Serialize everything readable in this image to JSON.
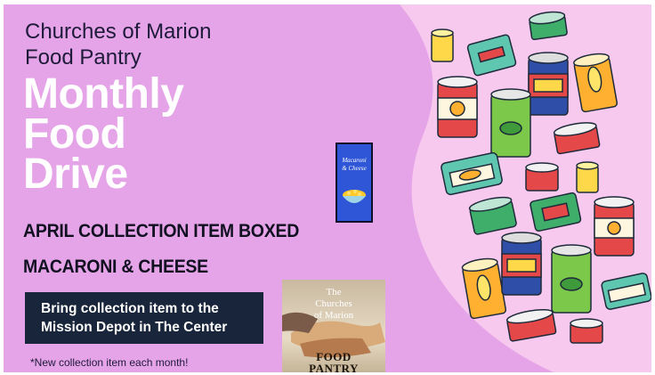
{
  "organization": {
    "line1": "Churches of Marion",
    "line2": "Food Pantry"
  },
  "headline": {
    "line1": "Monthly",
    "line2": "Food",
    "line3": "Drive"
  },
  "collection": {
    "line1": "APRIL COLLECTION ITEM BOXED",
    "line2": "MACARONI & CHEESE"
  },
  "depot_box": {
    "line1": "Bring collection item to the",
    "line2": "Mission Depot in The Center"
  },
  "footnote": "*New collection item each month!",
  "mac_box": {
    "line1": "Macaroni",
    "line2": "& Cheese"
  },
  "logo": {
    "top_line1": "The",
    "top_line2": "Churches",
    "top_line3": "of Marion",
    "bottom_line1": "FOOD",
    "bottom_line2": "PANTRY"
  },
  "colors": {
    "panel": "#e6a4e8",
    "light_pink": "#f7c9ee",
    "headline": "#ffffff",
    "depot_box": "#18253a",
    "mac_box": "#2f56d6"
  }
}
